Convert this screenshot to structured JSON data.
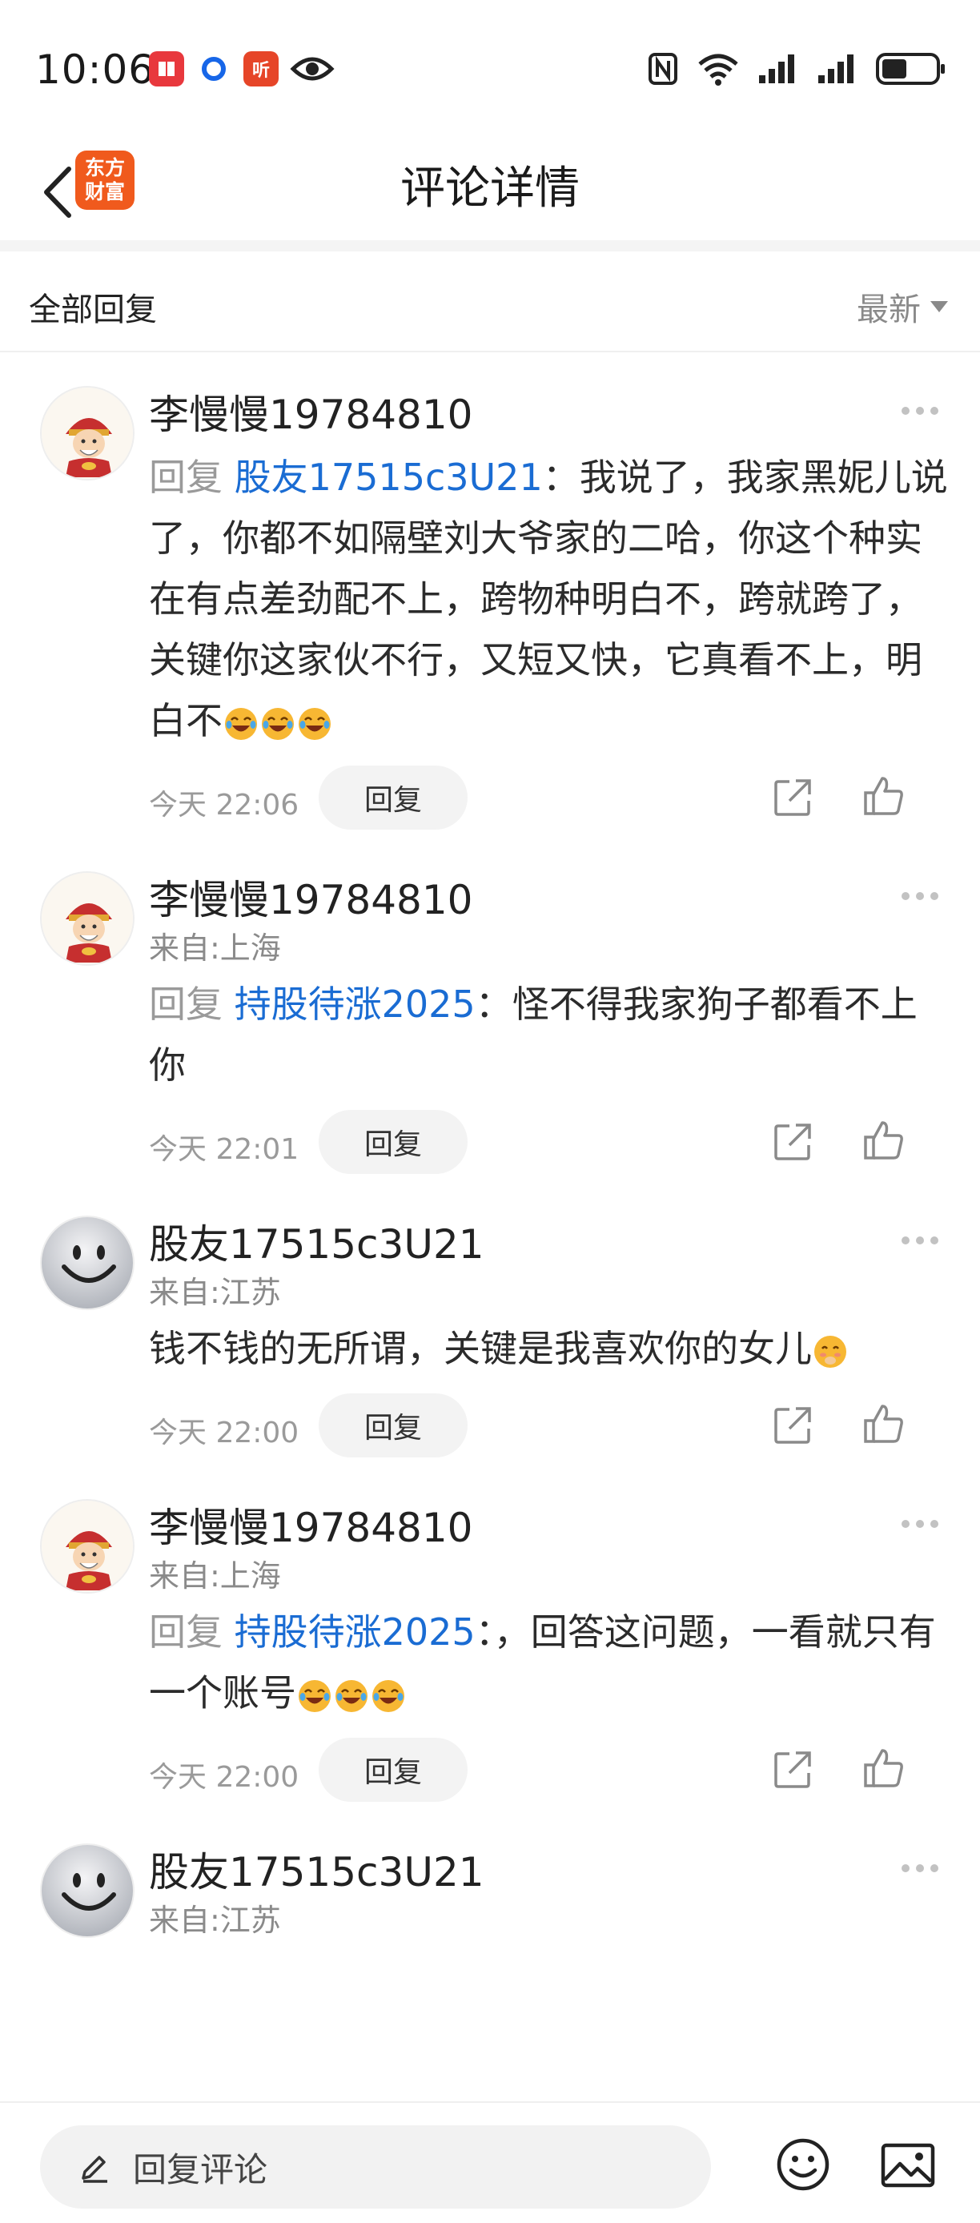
{
  "status_bar": {
    "time": "10:06",
    "app_icon_orange_text": "听"
  },
  "header": {
    "title": "评论详情",
    "logo_line1": "东方",
    "logo_line2": "财富"
  },
  "section": {
    "title": "全部回复",
    "sort_label": "最新"
  },
  "comments": [
    {
      "name": "李慢慢19784810",
      "from": "",
      "reply_prefix": "回复",
      "reply_target": "股友17515c3U21",
      "text": "：我说了，我家黑妮儿说了，你都不如隔壁刘大爷家的二哈，你这个种实在有点差劲配不上，跨物种明白不，跨就跨了，关键你这家伙不行，又短又快，它真看不上，明白不",
      "emojis": [
        "laugh-cry-emoji",
        "laugh-cry-emoji",
        "laugh-cry-emoji"
      ],
      "time": "今天 22:06",
      "reply_label": "回复",
      "avatar": "caishen-avatar"
    },
    {
      "name": "李慢慢19784810",
      "from": "来自:上海",
      "reply_prefix": "回复",
      "reply_target": "持股待涨2025",
      "text": "：怪不得我家狗子都看不上你",
      "emojis": [],
      "time": "今天 22:01",
      "reply_label": "回复",
      "avatar": "caishen-avatar"
    },
    {
      "name": "股友17515c3U21",
      "from": "来自:江苏",
      "reply_prefix": "",
      "reply_target": "",
      "text": "钱不钱的无所谓，关键是我喜欢你的女儿",
      "emojis": [
        "shy-emoji"
      ],
      "time": "今天 22:00",
      "reply_label": "回复",
      "avatar": "smiley-avatar"
    },
    {
      "name": "李慢慢19784810",
      "from": "来自:上海",
      "reply_prefix": "回复",
      "reply_target": "持股待涨2025",
      "text": "：，回答这问题，一看就只有一个账号",
      "emojis": [
        "laugh-cry-emoji",
        "laugh-cry-emoji",
        "laugh-cry-emoji"
      ],
      "time": "今天 22:00",
      "reply_label": "回复",
      "avatar": "caishen-avatar"
    },
    {
      "name": "股友17515c3U21",
      "from": "来自:江苏",
      "reply_prefix": "",
      "reply_target": "",
      "text": "",
      "emojis": [],
      "time": "",
      "reply_label": "",
      "avatar": "smiley-avatar"
    }
  ],
  "bottom_bar": {
    "placeholder": "回复评论"
  },
  "colors": {
    "link_blue": "#1a6cd3",
    "brand_orange": "#f05a1d",
    "muted_gray": "#9a9a9a"
  }
}
